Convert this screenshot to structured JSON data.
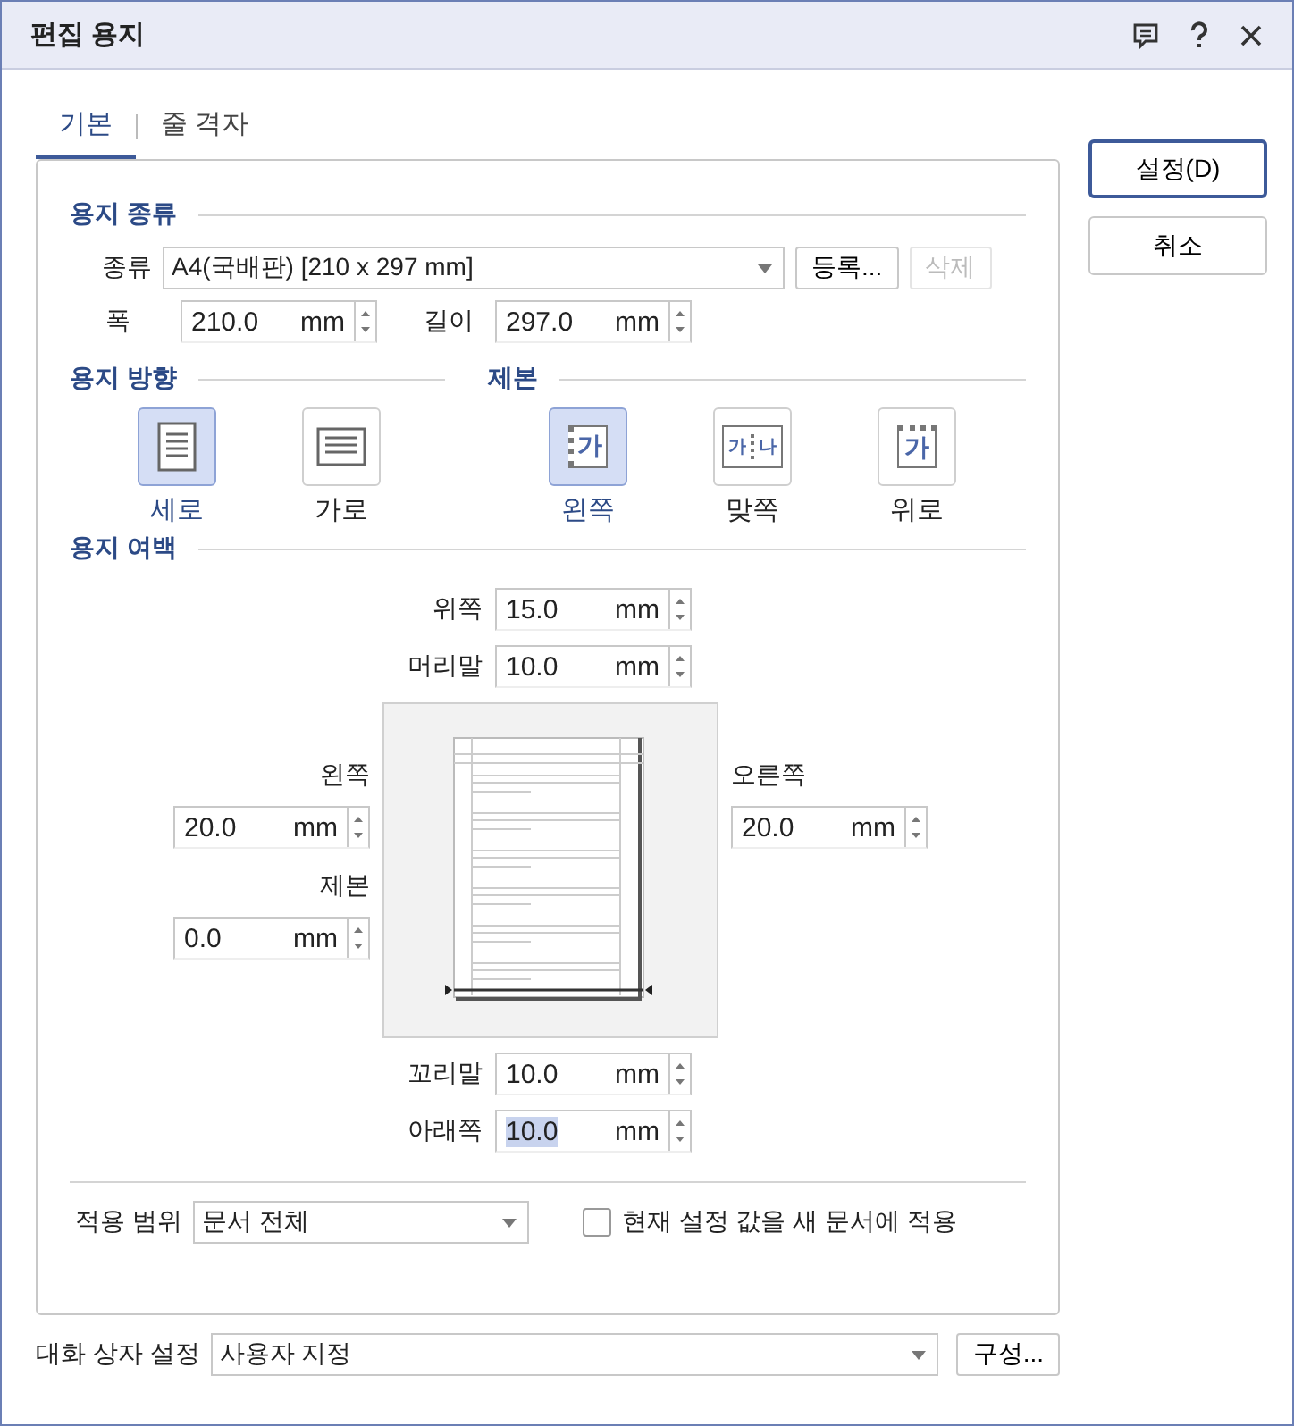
{
  "window": {
    "title": "편집 용지"
  },
  "tabs": [
    {
      "label": "기본",
      "selected": true
    },
    {
      "label": "줄 격자",
      "selected": false
    }
  ],
  "side_buttons": [
    {
      "label": "설정(D)",
      "default": true
    },
    {
      "label": "취소",
      "default": false
    }
  ],
  "paper_type": {
    "heading": "용지 종류",
    "type_label": "종류",
    "type_value": "A4(국배판)  [210 x 297 mm]",
    "register_button": {
      "label": "등록...",
      "disabled": false
    },
    "delete_button": {
      "label": "삭제",
      "disabled": true
    },
    "sizes": [
      {
        "label": "폭",
        "value": "210.0",
        "unit": "mm",
        "highlighted": false
      },
      {
        "label": "길이",
        "value": "297.0",
        "unit": "mm",
        "highlighted": false
      }
    ]
  },
  "orientation": {
    "heading": "용지 방향",
    "options": [
      {
        "label": "세로",
        "kind": "portrait",
        "selected": true
      },
      {
        "label": "가로",
        "kind": "landscape",
        "selected": false
      }
    ]
  },
  "binding": {
    "heading": "제본",
    "options": [
      {
        "label": "왼쪽",
        "kind": "left",
        "icon_text": [
          "가"
        ],
        "selected": true
      },
      {
        "label": "맞쪽",
        "kind": "facing",
        "icon_text": [
          "가",
          "나"
        ],
        "selected": false
      },
      {
        "label": "위로",
        "kind": "top",
        "icon_text": [
          "가"
        ],
        "selected": false
      }
    ]
  },
  "margins": {
    "heading": "용지 여백",
    "top": {
      "label": "위쪽",
      "value": "15.0",
      "unit": "mm",
      "highlighted": false
    },
    "header": {
      "label": "머리말",
      "value": "10.0",
      "unit": "mm",
      "highlighted": false
    },
    "left": {
      "label": "왼쪽",
      "value": "20.0",
      "unit": "mm",
      "highlighted": false
    },
    "gutter": {
      "label": "제본",
      "value": "0.0",
      "unit": "mm",
      "highlighted": false
    },
    "right": {
      "label": "오른쪽",
      "value": "20.0",
      "unit": "mm",
      "highlighted": false
    },
    "footer": {
      "label": "꼬리말",
      "value": "10.0",
      "unit": "mm",
      "highlighted": false
    },
    "bottom": {
      "label": "아래쪽",
      "value": "10.0",
      "unit": "mm",
      "highlighted": true
    }
  },
  "apply": {
    "label": "적용 범위",
    "value": "문서 전체",
    "checkbox": {
      "label": "현재 설정 값을 새 문서에 적용",
      "checked": false
    }
  },
  "dialog_settings": {
    "label": "대화 상자 설정",
    "value": "사용자 지정",
    "button": "구성..."
  }
}
